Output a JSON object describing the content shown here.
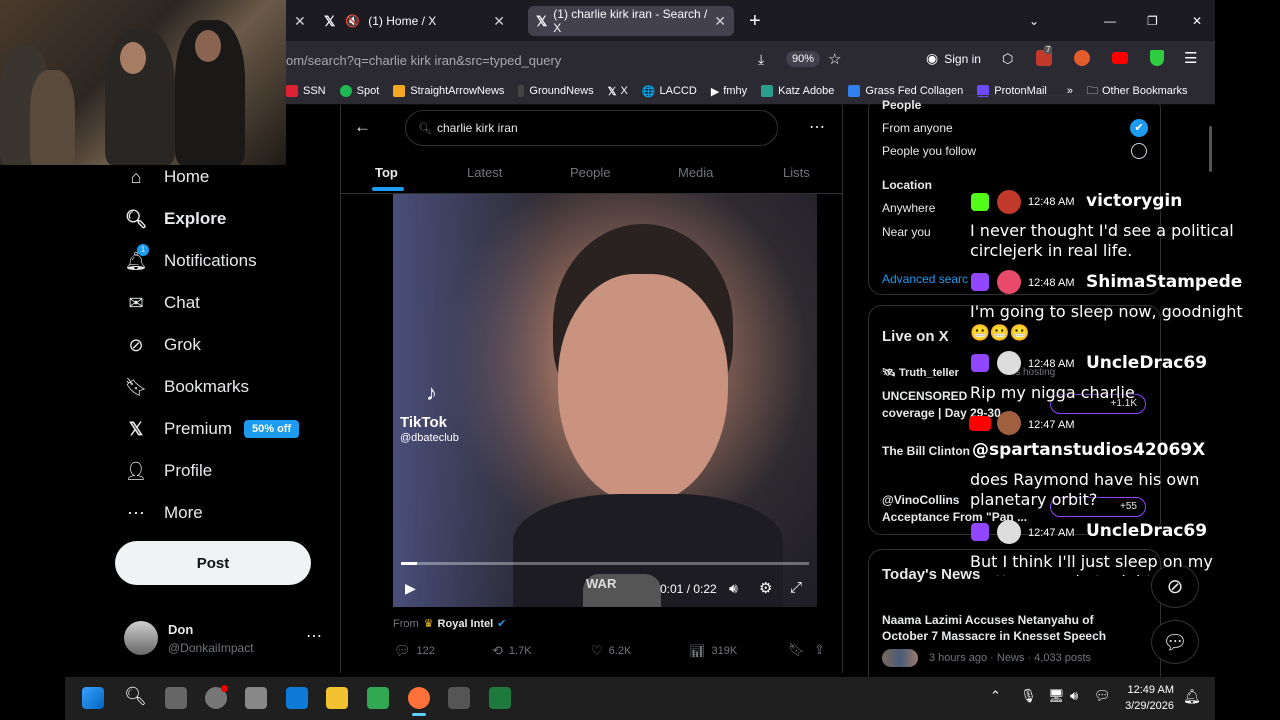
{
  "browser": {
    "tabs": [
      {
        "label": "",
        "close": "✕"
      },
      {
        "label": "(1) Home / X",
        "close": "✕"
      },
      {
        "label": "(1) charlie kirk iran - Search / X",
        "close": "✕"
      }
    ],
    "new_tab": "+",
    "url": "om/search?q=charlie kirk iran&src=typed_query",
    "zoom": "90%",
    "sign_in": "Sign in",
    "ext_badge": "7",
    "bookmarks": [
      "SSN",
      "Spot",
      "StraightArrowNews",
      "GroundNews",
      "X",
      "LACCD",
      "fmhy",
      "Katz Adobe",
      "Grass Fed Collagen",
      "ProtonMail"
    ],
    "other_bookmarks": "Other Bookmarks",
    "win_min": "—",
    "win_max": "❐",
    "win_close": "✕"
  },
  "nav": {
    "items": [
      {
        "label": "Home",
        "icon": "home-icon"
      },
      {
        "label": "Explore",
        "icon": "search-icon"
      },
      {
        "label": "Notifications",
        "icon": "bell-icon"
      },
      {
        "label": "Chat",
        "icon": "mail-icon"
      },
      {
        "label": "Grok",
        "icon": "grok-icon"
      },
      {
        "label": "Bookmarks",
        "icon": "bookmark-icon"
      },
      {
        "label": "Premium",
        "icon": "x-icon"
      },
      {
        "label": "Profile",
        "icon": "person-icon"
      },
      {
        "label": "More",
        "icon": "more-icon"
      }
    ],
    "notif_count": "1",
    "premium_badge": "50% off",
    "post": "Post",
    "user_name": "Don",
    "user_handle": "@DonkaiImpact"
  },
  "search": {
    "query": "charlie kirk iran",
    "tabs": [
      "Top",
      "Latest",
      "People",
      "Media",
      "Lists"
    ]
  },
  "video": {
    "watermark": "TikTok",
    "watermark_handle": "@dbateclub",
    "time": "0:01 / 0:22",
    "mic_text": "WAR",
    "progress": 0.04
  },
  "tweet": {
    "from_label": "From",
    "from_name": "Royal Intel",
    "replies": "122",
    "reposts": "1.7K",
    "likes": "6.2K",
    "views": "319K"
  },
  "right": {
    "people_head": "People",
    "from_anyone": "From anyone",
    "people_you_follow": "People you follow",
    "location_head": "Location",
    "anywhere": "Anywhere",
    "near_you": "Near you",
    "advanced": "Advanced searc",
    "live_head": "Live on X",
    "live1_user": "Truth_teller",
    "live1_status": "is hosting",
    "live1_title": "UNCENSORED",
    "live1_title2": "coverage | Day 29-30...",
    "live1_count": "+1.1K",
    "live2_title": "The Bill Clinton",
    "live3_user": "@VinoCollins",
    "live3_title": "Acceptance From \"Pan ...",
    "live3_count": "+55",
    "news_head": "Today's News",
    "news1_title": "Naama Lazimi Accuses Netanyahu of October 7 Massacre in Knesset Speech",
    "news1_meta": "3 hours ago · News · 4,033 posts"
  },
  "chat": [
    {
      "time": "12:48 AM",
      "user": "victorygin",
      "msg": "I never thought I'd see a political circlejerk in real life.",
      "platform": "kick"
    },
    {
      "time": "12:48 AM",
      "user": "ShimaStampede",
      "msg": "I'm going to sleep now, goodnight",
      "platform": "twitch"
    },
    {
      "time": "12:48 AM",
      "user": "UncleDrac69",
      "msg": "Rip my nigga charlie",
      "platform": "twitch"
    },
    {
      "time": "12:47 AM",
      "user": "@spartanstudios42069X",
      "msg": "does Raymond have his own planetary orbit?",
      "platform": "youtube"
    },
    {
      "time": "12:47 AM",
      "user": "UncleDrac69",
      "msg": "But I think I'll just sleep on my mattress again tonight",
      "platform": "twitch"
    }
  ],
  "taskbar": {
    "time": "12:49 AM",
    "date": "3/29/2026"
  },
  "colors": {
    "accent": "#1d9bf0",
    "bg": "#000000",
    "twitch": "#9146ff",
    "kick": "#53fc18",
    "youtube": "#ff0000"
  }
}
